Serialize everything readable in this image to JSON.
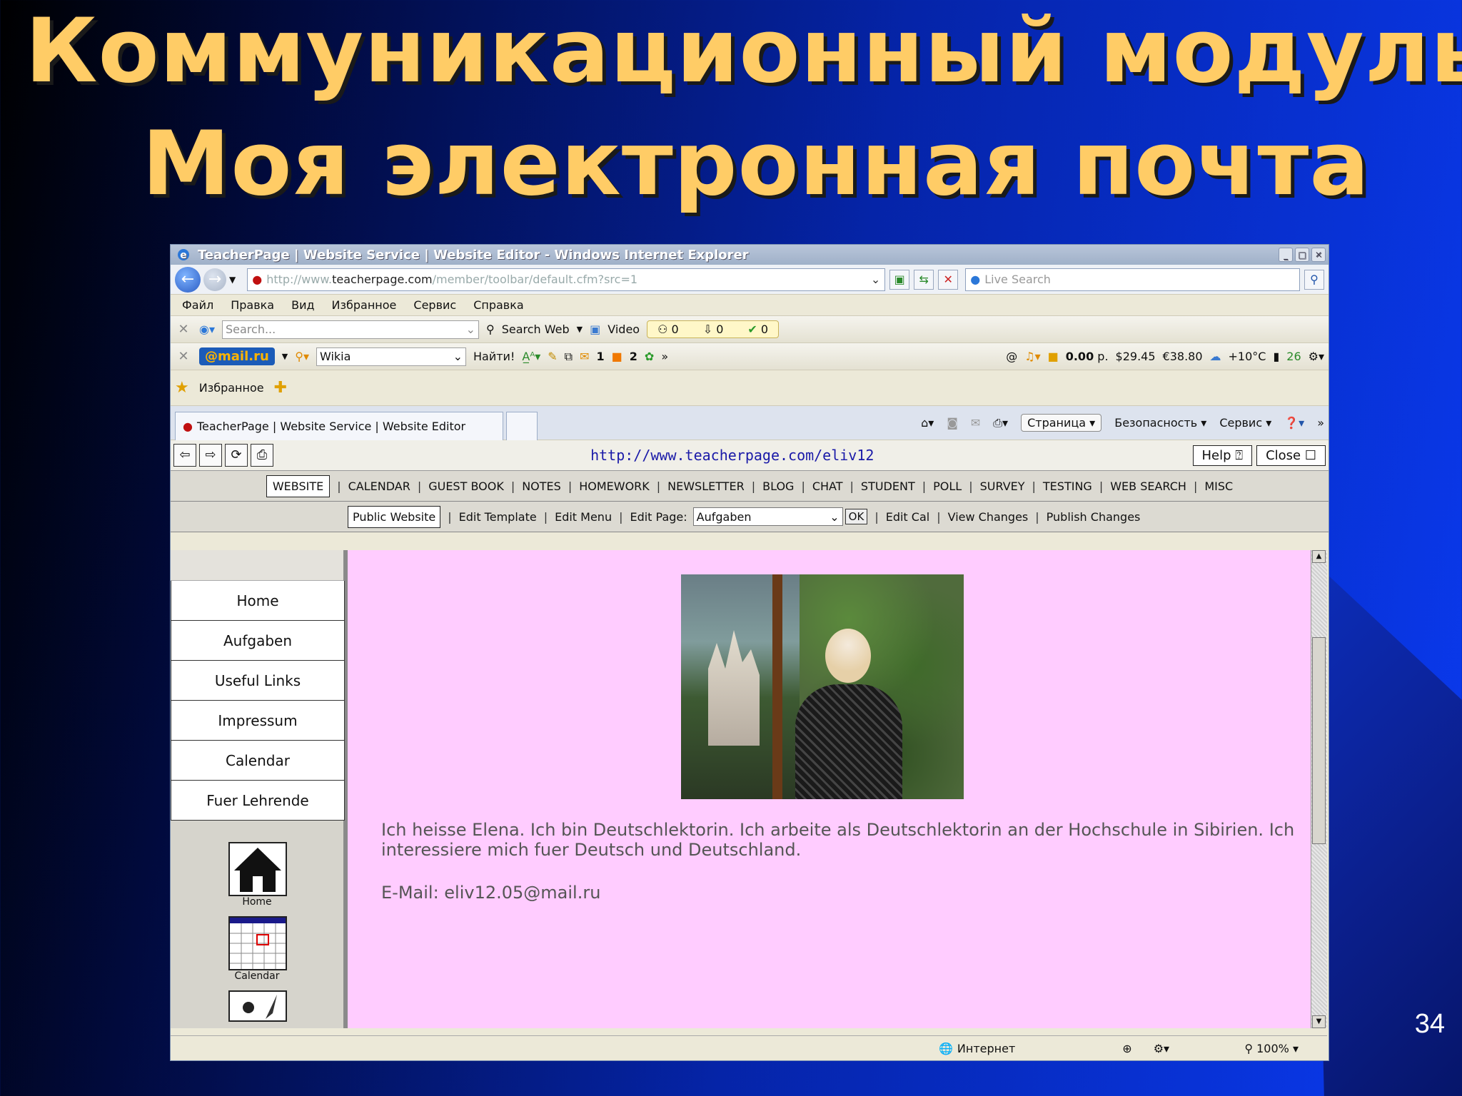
{
  "slide": {
    "title_line1": "Коммуникационный модуль",
    "title_line2": "Моя электронная почта",
    "page_number": "34"
  },
  "window": {
    "title": "TeacherPage | Website Service | Website Editor - Windows Internet Explorer"
  },
  "address": {
    "url_prefix": "http://www.",
    "url_domain": "teacherpage.com",
    "url_rest": "/member/toolbar/default.cfm?src=1",
    "live_search_placeholder": "Live Search"
  },
  "menu": [
    "Файл",
    "Правка",
    "Вид",
    "Избранное",
    "Сервис",
    "Справка"
  ],
  "toolbar1": {
    "search_placeholder": "Search...",
    "search_web": "Search Web",
    "video": "Video",
    "counter1": "0",
    "counter2": "0",
    "counter3": "0"
  },
  "toolbar2": {
    "brand": "@mail.ru",
    "search_value": "Wikia",
    "find_label": "Найти!",
    "mail_count": "1",
    "ok_count": "2",
    "balance": "0.00",
    "balance_unit": "р.",
    "usd": "$29.45",
    "eur": "€38.80",
    "weather": "+10°C",
    "traffic": "26"
  },
  "favorites": {
    "label": "Избранное"
  },
  "tab": {
    "label": "TeacherPage | Website Service | Website Editor"
  },
  "cmdbar": {
    "page": "Страница",
    "safety": "Безопасность",
    "tools": "Сервис"
  },
  "teacherpage": {
    "url": "http://www.teacherpage.com/eliv12",
    "help": "Help",
    "close": "Close",
    "nav": [
      "WEBSITE",
      "CALENDAR",
      "GUEST BOOK",
      "NOTES",
      "HOMEWORK",
      "NEWSLETTER",
      "BLOG",
      "CHAT",
      "STUDENT",
      "POLL",
      "SURVEY",
      "TESTING",
      "WEB SEARCH",
      "MISC"
    ],
    "sub": {
      "public": "Public Website",
      "edit_template": "Edit Template",
      "edit_menu": "Edit Menu",
      "edit_page_label": "Edit Page:",
      "page_value": "Aufgaben",
      "ok": "OK",
      "edit_cal": "Edit Cal",
      "view_changes": "View Changes",
      "publish": "Publish Changes"
    },
    "sidebar": [
      "Home",
      "Aufgaben",
      "Useful Links",
      "Impressum",
      "Calendar",
      "Fuer Lehrende"
    ],
    "side_icons": [
      "Home",
      "Calendar"
    ],
    "bio": "Ich heisse Elena. Ich bin Deutschlektorin. Ich arbeite als Deutschlektorin an der Hochschule in Sibirien. Ich interessiere mich fuer Deutsch und Deutschland.",
    "email": "E-Mail: eliv12.05@mail.ru"
  },
  "status": {
    "zone": "Интернет",
    "zoom": "100%"
  }
}
